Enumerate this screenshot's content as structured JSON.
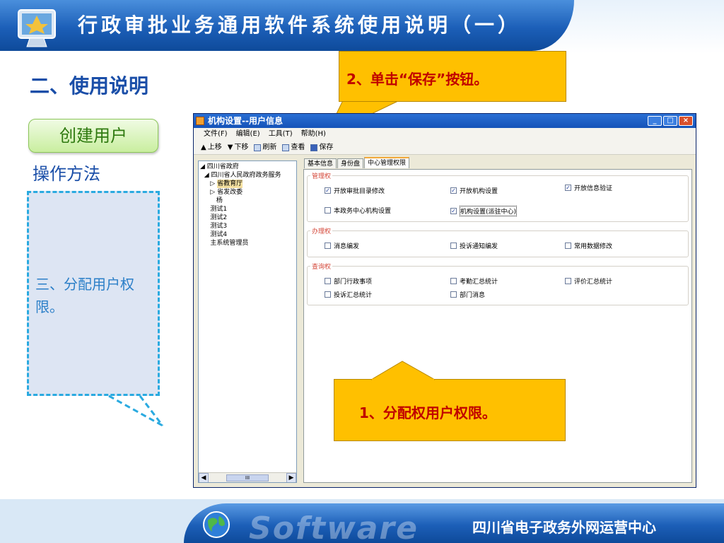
{
  "header": {
    "title": "行政审批业务通用软件系统使用说明（一）"
  },
  "section_title": "二、使用说明",
  "create_user_button": "创建用户",
  "method_label": "操作方法",
  "left_note": "三、分配用户权限。",
  "callouts": {
    "save_step": "2、单击“保存”按钮。",
    "assign_step": "1、分配权用户权限。"
  },
  "window": {
    "title": "机构设置--用户信息",
    "menu": [
      "文件(F)",
      "编辑(E)",
      "工具(T)",
      "帮助(H)"
    ],
    "toolbar": {
      "up": "上移",
      "down": "下移",
      "refresh": "刷新",
      "view": "查看",
      "save": "保存"
    },
    "tree": [
      "四川省政府",
      "四川省人民政府政务服务",
      "省教育厅",
      "省发改委",
      "杨",
      "测试1",
      "测试2",
      "测试3",
      "测试4",
      "主系统管理员"
    ],
    "tree_scroll_thumb": "III",
    "tabs": [
      "基本信息",
      "身份盘",
      "中心管理权限"
    ],
    "groups": [
      {
        "title": "管理权",
        "items": [
          {
            "label": "开放审批目录修改",
            "checked": true
          },
          {
            "label": "开放机构设置",
            "checked": true
          },
          {
            "label": "开放信息验证",
            "checked": true
          },
          {
            "label": "本政务中心机构设置",
            "checked": false
          },
          {
            "label": "机构设置(派驻中心)",
            "checked": true
          }
        ]
      },
      {
        "title": "办理权",
        "items": [
          {
            "label": "消息编发",
            "checked": false
          },
          {
            "label": "投诉通知编发",
            "checked": false
          },
          {
            "label": "常用数据修改",
            "checked": false
          }
        ]
      },
      {
        "title": "查询权",
        "items": [
          {
            "label": "部门行政事项",
            "checked": false
          },
          {
            "label": "考勤汇总统计",
            "checked": false
          },
          {
            "label": "评价汇总统计",
            "checked": false
          },
          {
            "label": "投诉汇总统计",
            "checked": false
          },
          {
            "label": "部门消息",
            "checked": false
          }
        ]
      }
    ]
  },
  "footer": {
    "brand": "Software",
    "org": "四川省电子政务外网运营中心"
  },
  "colors": {
    "header_blue": "#1c5fb8",
    "callout_fill": "#ffc000",
    "callout_text": "#c00000",
    "group_title": "#d4483a"
  }
}
